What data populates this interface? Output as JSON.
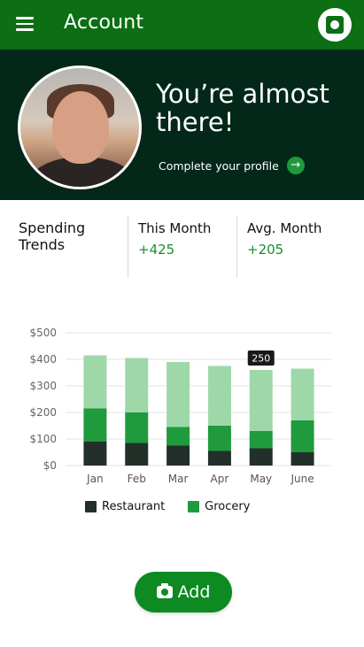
{
  "appbar": {
    "title": "Account",
    "menu_icon": "menu-icon",
    "logo_icon": "app-logo-icon",
    "background": "#0c6f14"
  },
  "hero": {
    "headline": "You’re almost there!",
    "link_label": "Complete your profile",
    "arrow_icon": "arrow-right-icon",
    "background": "#03281a"
  },
  "stats": {
    "trends_label": "Spending Trends",
    "this_month": {
      "label": "This Month",
      "value": "+425"
    },
    "avg_month": {
      "label": "Avg. Month",
      "value": "+205"
    }
  },
  "chart_data": {
    "type": "bar",
    "stacked": true,
    "categories": [
      "Jan",
      "Feb",
      "Mar",
      "Apr",
      "May",
      "June"
    ],
    "series": [
      {
        "name": "Restaurant",
        "values": [
          90,
          85,
          75,
          55,
          65,
          50
        ],
        "color": "#23302a"
      },
      {
        "name": "Grocery",
        "values": [
          125,
          115,
          70,
          95,
          65,
          120
        ],
        "color": "#1f9a3d"
      },
      {
        "values": [
          200,
          205,
          245,
          225,
          230,
          195
        ],
        "color": "#9ed8a9"
      }
    ],
    "yticks": [
      "$0",
      "$100",
      "$200",
      "$300",
      "$400",
      "$500"
    ],
    "ylim": [
      0,
      500
    ],
    "grid": true,
    "tooltip": {
      "category": "May",
      "label": "250"
    }
  },
  "legend": {
    "restaurant": "Restaurant",
    "grocery": "Grocery"
  },
  "add_button": {
    "label": "Add",
    "icon": "camera-icon"
  }
}
